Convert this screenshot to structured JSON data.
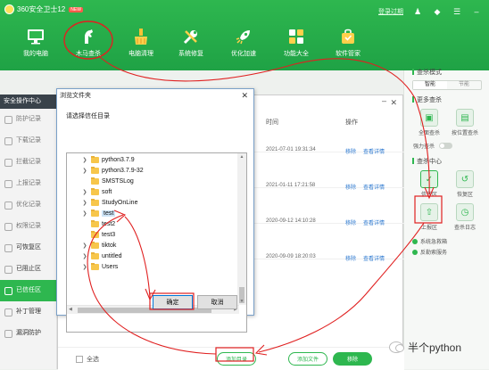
{
  "app": {
    "title": "360安全卫士12",
    "badge": "NEW",
    "login_link": "登录过期"
  },
  "toolbar": [
    {
      "label": "我的电脑",
      "icon": "monitor-icon"
    },
    {
      "label": "木马查杀",
      "icon": "horse-shield-icon"
    },
    {
      "label": "电脑清理",
      "icon": "broom-icon"
    },
    {
      "label": "系统修复",
      "icon": "wrench-icon"
    },
    {
      "label": "优化加速",
      "icon": "rocket-icon"
    },
    {
      "label": "功能大全",
      "icon": "apps-grid-icon"
    },
    {
      "label": "软件管家",
      "icon": "software-bag-icon"
    }
  ],
  "right_panel": {
    "mode_heading": "查杀模式",
    "mode_options": [
      "智能",
      "节能"
    ],
    "scan_heading": "更多查杀",
    "scan_items": [
      "全面查杀",
      "按位置查杀"
    ],
    "toggle_label": "强力查杀",
    "center_heading": "查杀中心",
    "center_items": [
      "信任区",
      "恢复区",
      "上报区",
      "查杀日志"
    ],
    "checks": [
      "系统急救箱",
      "反勒索服务"
    ]
  },
  "left_sidebar": {
    "header": "安全操作中心",
    "items": [
      "防护记录",
      "下载记录",
      "拦截记录",
      "上报记录",
      "优化记录",
      "权限记录",
      "可恢复区",
      "已阻止区",
      "已信任区",
      "补丁管理",
      "漏洞防护"
    ]
  },
  "main_window": {
    "col_time": "时间",
    "col_action": "操作",
    "rows": [
      {
        "date": "2021-07-01 19:31:34",
        "remove": "移除",
        "view": "查看详情"
      },
      {
        "date": "2021-01-11 17:21:58",
        "remove": "移除",
        "view": "查看详情"
      },
      {
        "date": "2020-09-12 14:10:28",
        "remove": "移除",
        "view": "查看详情"
      },
      {
        "date": "2020-09-09 18:20:03",
        "remove": "移除",
        "view": "查看详情"
      }
    ],
    "select_all": "全选",
    "btn_add_dir": "添加目录",
    "btn_add_file": "添加文件",
    "btn_remove": "移除"
  },
  "dialog": {
    "title": "浏览文件夹",
    "prompt": "请选择信任目录",
    "folders": [
      "python3.7.9",
      "python3.7.9-32",
      "SMSTSLog",
      "soft",
      "StudyOnLine",
      "test",
      "test2",
      "test3",
      "tiktok",
      "untitled",
      "Users"
    ],
    "selected": "test",
    "ok": "确定",
    "cancel": "取消"
  },
  "watermark": "半个python",
  "colors": {
    "brand_green": "#2eb74f",
    "annotation_red": "#e02020",
    "link_blue": "#2e7ad1"
  }
}
